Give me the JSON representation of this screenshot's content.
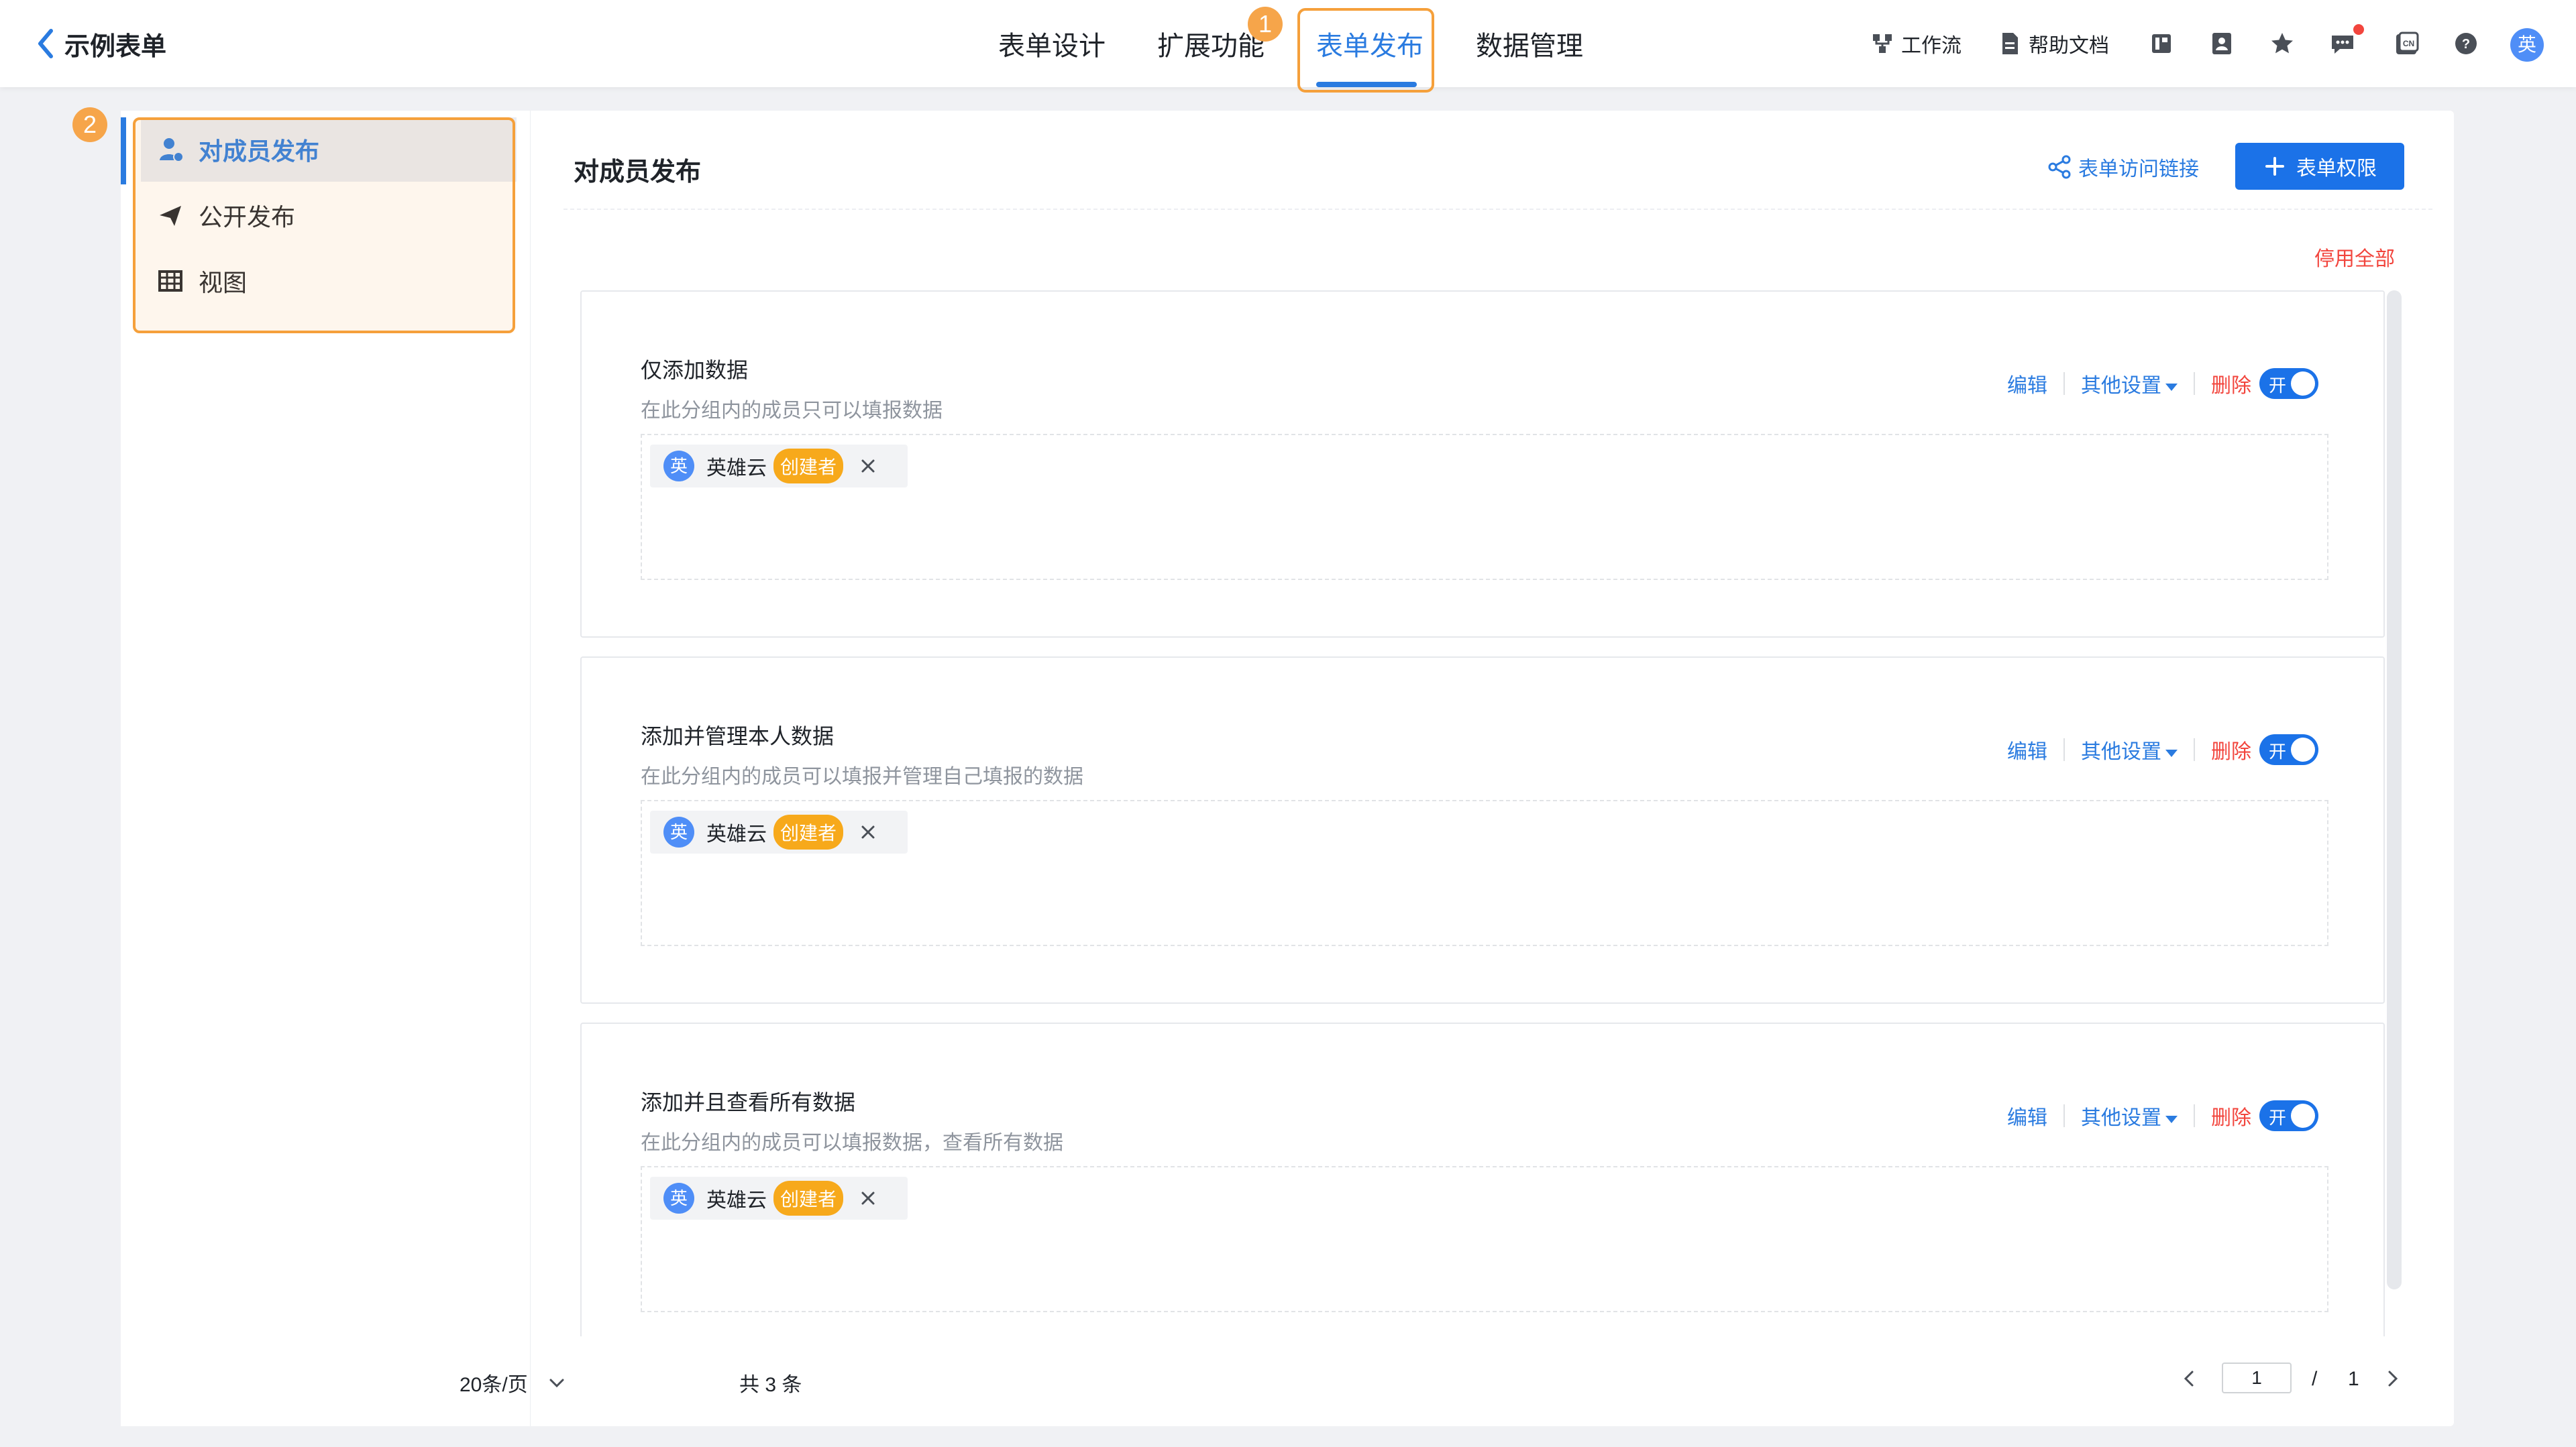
{
  "header": {
    "back_title": "示例表单",
    "tabs": [
      {
        "label": "表单设计"
      },
      {
        "label": "扩展功能"
      },
      {
        "label": "表单发布"
      },
      {
        "label": "数据管理"
      }
    ],
    "badge_1": "1",
    "badge_2": "2",
    "tools": {
      "workflow": "工作流",
      "help_docs": "帮助文档"
    },
    "avatar_text": "英",
    "icons": [
      "workflow-icon",
      "help-doc-icon",
      "layout-icon",
      "contacts-icon",
      "star-icon",
      "message-icon",
      "language-cn-icon",
      "help-icon"
    ]
  },
  "sidebar": {
    "items": [
      {
        "label": "对成员发布",
        "icon": "member-icon"
      },
      {
        "label": "公开发布",
        "icon": "send-icon"
      },
      {
        "label": "视图",
        "icon": "table-icon"
      }
    ]
  },
  "content": {
    "title": "对成员发布",
    "share_link": "表单访问链接",
    "permission_button": "表单权限",
    "stop_all": "停用全部",
    "cards": [
      {
        "title": "仅添加数据",
        "desc": "在此分组内的成员只可以填报数据",
        "member": {
          "avatar": "英",
          "name": "英雄云",
          "tag": "创建者"
        },
        "actions": {
          "edit": "编辑",
          "other": "其他设置",
          "delete": "删除",
          "toggle": "开"
        }
      },
      {
        "title": "添加并管理本人数据",
        "desc": "在此分组内的成员可以填报并管理自己填报的数据",
        "member": {
          "avatar": "英",
          "name": "英雄云",
          "tag": "创建者"
        },
        "actions": {
          "edit": "编辑",
          "other": "其他设置",
          "delete": "删除",
          "toggle": "开"
        }
      },
      {
        "title": "添加并且查看所有数据",
        "desc": "在此分组内的成员可以填报数据，查看所有数据",
        "member": {
          "avatar": "英",
          "name": "英雄云",
          "tag": "创建者"
        },
        "actions": {
          "edit": "编辑",
          "other": "其他设置",
          "delete": "删除",
          "toggle": "开"
        }
      }
    ]
  },
  "pagination": {
    "page_size": "20条/页",
    "total": "共 3 条",
    "current_page": "1",
    "slash": "/",
    "total_pages": "1"
  },
  "colors": {
    "primary": "#1b72e8",
    "highlight": "#f5a03b",
    "danger": "#f2453d",
    "tag": "#f7a91b"
  }
}
